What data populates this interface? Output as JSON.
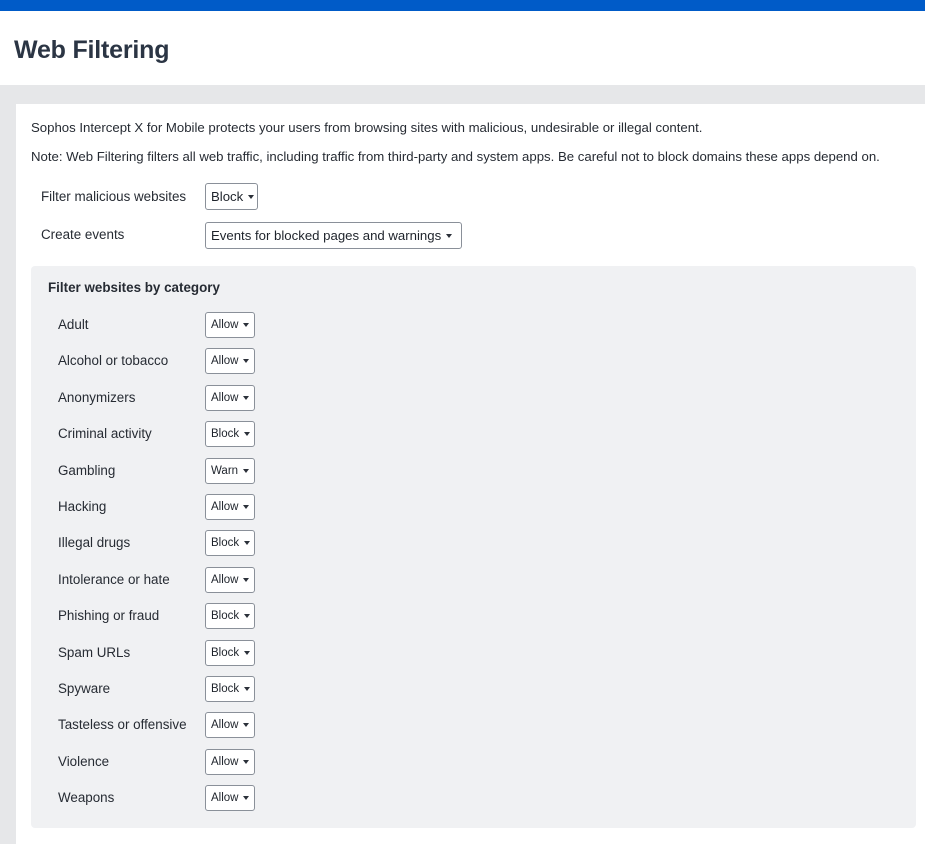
{
  "page": {
    "title": "Web Filtering"
  },
  "intro": {
    "line1": "Sophos Intercept X for Mobile protects your users from browsing sites with malicious, undesirable or illegal content.",
    "line2": "Note: Web Filtering filters all web traffic, including traffic from third-party and system apps. Be careful not to block domains these apps depend on."
  },
  "settings": {
    "malicious": {
      "label": "Filter malicious websites",
      "value": "Block"
    },
    "events": {
      "label": "Create events",
      "value": "Events for blocked pages and warnings"
    }
  },
  "categories": {
    "title": "Filter websites by category",
    "items": [
      {
        "label": "Adult",
        "value": "Allow"
      },
      {
        "label": "Alcohol or tobacco",
        "value": "Allow"
      },
      {
        "label": "Anonymizers",
        "value": "Allow"
      },
      {
        "label": "Criminal activity",
        "value": "Block"
      },
      {
        "label": "Gambling",
        "value": "Warn"
      },
      {
        "label": "Hacking",
        "value": "Allow"
      },
      {
        "label": "Illegal drugs",
        "value": "Block"
      },
      {
        "label": "Intolerance or hate",
        "value": "Allow"
      },
      {
        "label": "Phishing or fraud",
        "value": "Block"
      },
      {
        "label": "Spam URLs",
        "value": "Block"
      },
      {
        "label": "Spyware",
        "value": "Block"
      },
      {
        "label": "Tasteless or offensive",
        "value": "Allow"
      },
      {
        "label": "Violence",
        "value": "Allow"
      },
      {
        "label": "Weapons",
        "value": "Allow"
      }
    ]
  }
}
